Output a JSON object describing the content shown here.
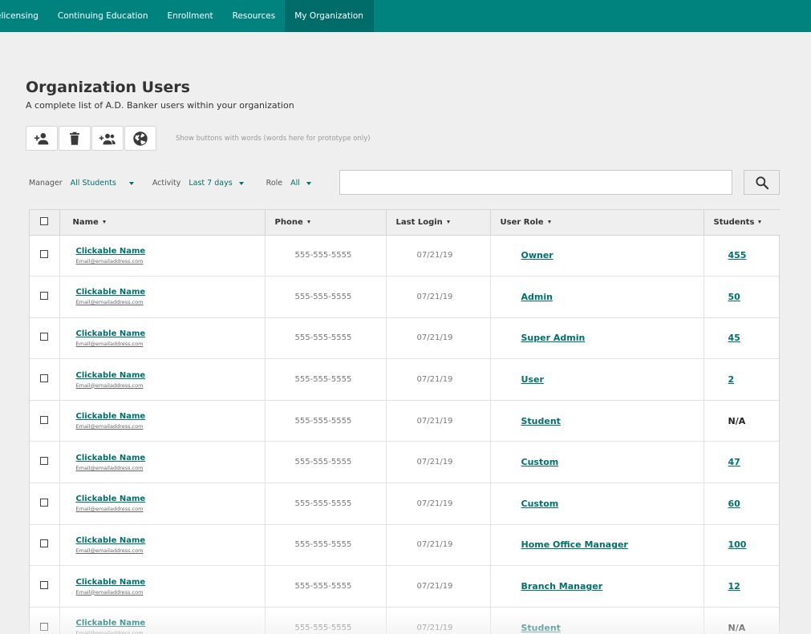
{
  "nav": {
    "items": [
      {
        "label": "elicensing"
      },
      {
        "label": "Continuing Education"
      },
      {
        "label": "Enrollment"
      },
      {
        "label": "Resources"
      },
      {
        "label": "My Organization",
        "active": true
      }
    ]
  },
  "page": {
    "title": "Organization Users",
    "subtitle": "A complete list of A.D. Banker users within your organization"
  },
  "toolbar": {
    "buttons": [
      {
        "icon": "add-user-icon"
      },
      {
        "icon": "trash-icon"
      },
      {
        "icon": "add-group-icon"
      },
      {
        "icon": "globe-icon"
      }
    ],
    "hint": "Show buttons with words (words here for prototype only)"
  },
  "filters": {
    "manager": {
      "label": "Manager",
      "value": "All Students"
    },
    "activity": {
      "label": "Activity",
      "value": "Last 7 days"
    },
    "role": {
      "label": "Role",
      "value": "All"
    }
  },
  "search": {
    "placeholder": "",
    "value": ""
  },
  "table": {
    "headers": {
      "name": "Name",
      "phone": "Phone",
      "last_login": "Last Login",
      "user_role": "User Role",
      "students": "Students"
    },
    "rows": [
      {
        "name": "Clickable Name",
        "email": "Email@emailaddress.com",
        "phone": "555-555-5555",
        "last_login": "07/21/19",
        "role": "Owner",
        "students": "455",
        "students_link": true
      },
      {
        "name": "Clickable Name",
        "email": "Email@emailaddress.com",
        "phone": "555-555-5555",
        "last_login": "07/21/19",
        "role": "Admin",
        "students": "50",
        "students_link": true
      },
      {
        "name": "Clickable Name",
        "email": "Email@emailaddress.com",
        "phone": "555-555-5555",
        "last_login": "07/21/19",
        "role": "Super Admin",
        "students": "45",
        "students_link": true
      },
      {
        "name": "Clickable Name",
        "email": "Email@emailaddress.com",
        "phone": "555-555-5555",
        "last_login": "07/21/19",
        "role": "User",
        "students": "2",
        "students_link": true
      },
      {
        "name": "Clickable Name",
        "email": "Email@emailaddress.com",
        "phone": "555-555-5555",
        "last_login": "07/21/19",
        "role": "Student",
        "students": "N/A",
        "students_link": false
      },
      {
        "name": "Clickable Name",
        "email": "Email@emailaddress.com",
        "phone": "555-555-5555",
        "last_login": "07/21/19",
        "role": "Custom",
        "students": "47",
        "students_link": true
      },
      {
        "name": "Clickable Name",
        "email": "Email@emailaddress.com",
        "phone": "555-555-5555",
        "last_login": "07/21/19",
        "role": "Custom",
        "students": "60",
        "students_link": true
      },
      {
        "name": "Clickable Name",
        "email": "Email@emailaddress.com",
        "phone": "555-555-5555",
        "last_login": "07/21/19",
        "role": "Home Office Manager",
        "students": "100",
        "students_link": true
      },
      {
        "name": "Clickable Name",
        "email": "Email@emailaddress.com",
        "phone": "555-555-5555",
        "last_login": "07/21/19",
        "role": "Branch Manager",
        "students": "12",
        "students_link": true
      },
      {
        "name": "Clickable Name",
        "email": "Email@emailaddress.com",
        "phone": "555-555-5555",
        "last_login": "07/21/19",
        "role": "Student",
        "students": "N/A",
        "students_link": false
      }
    ]
  },
  "colors": {
    "nav_bg": "#00837f",
    "nav_active": "#006c69",
    "link": "#00706c",
    "page_bg": "#efefef"
  }
}
